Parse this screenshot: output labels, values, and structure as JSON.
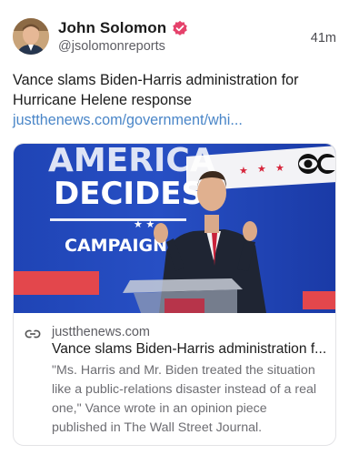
{
  "post": {
    "author": {
      "name": "John Solomon",
      "handle": "@jsolomonreports",
      "verified_color": "#e5426b"
    },
    "time": "41m",
    "text": "Vance slams Biden-Harris administration for Hurricane Helene response ",
    "link_text": "justthenews.com/government/whi...",
    "link_color": "#4a86c8"
  },
  "card": {
    "image": {
      "banner_line1": "AMERICA",
      "banner_line2": "DECIDES",
      "banner_line3": "CAMPAIGN",
      "network_logo": "CBS-eye"
    },
    "domain": "justthenews.com",
    "title": "Vance slams Biden-Harris administration for Hurricane Helene response",
    "description": "\"Ms. Harris and Mr. Biden treated the situation like a public-relations disaster instead of a real one,\" Vance wrote in an opinion piece published in The Wall Street Journal."
  }
}
